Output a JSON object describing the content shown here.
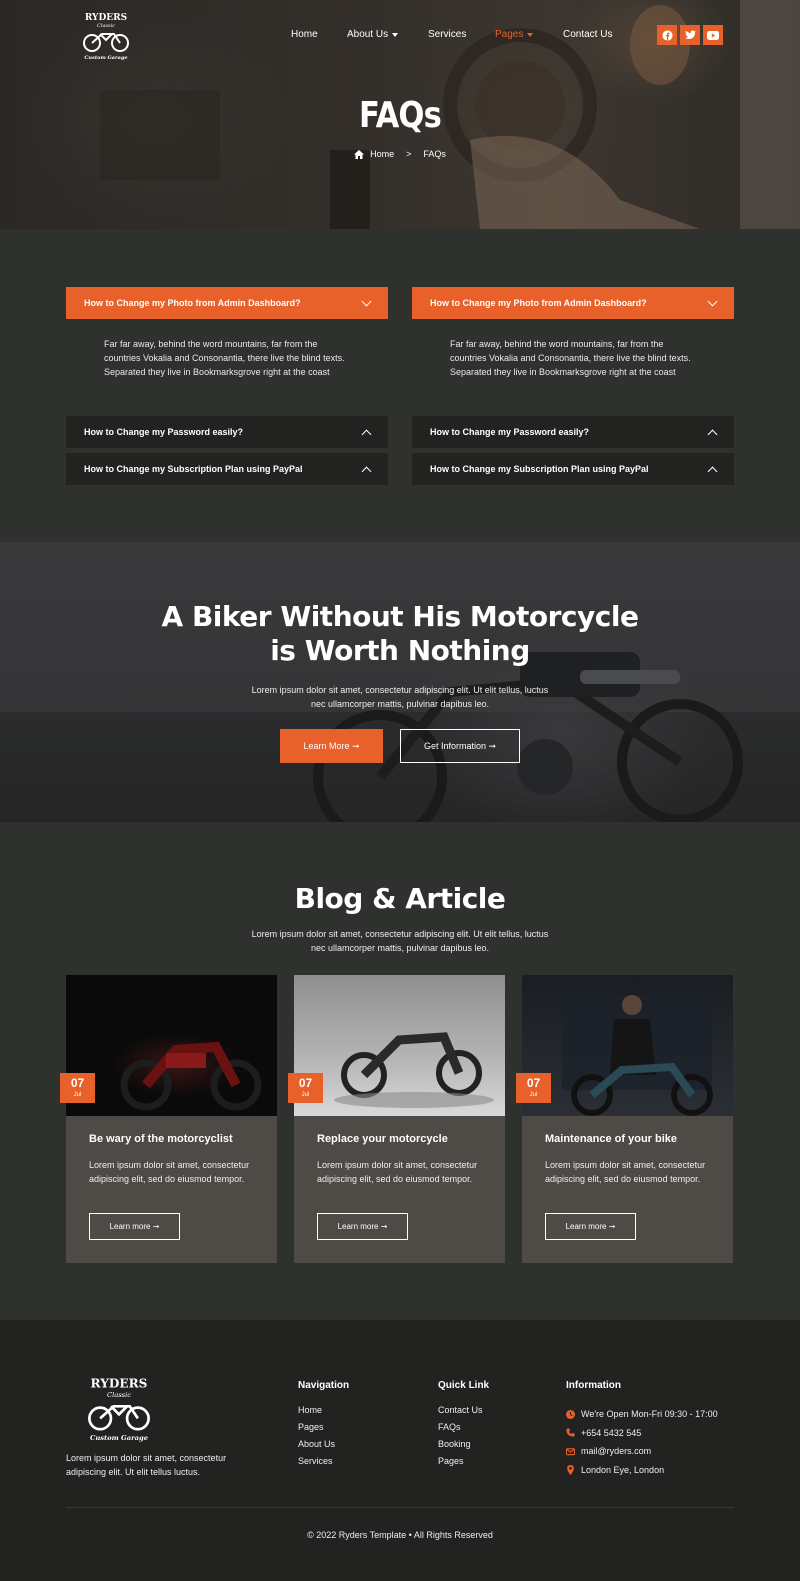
{
  "header": {
    "logo_top": "RYDERS",
    "logo_mid": "Classic",
    "logo_bottom": "Custom Garage",
    "nav": [
      {
        "label": "Home"
      },
      {
        "label": "About Us"
      },
      {
        "label": "Services"
      },
      {
        "label": "Pages"
      },
      {
        "label": "Contact Us"
      }
    ],
    "social": [
      "facebook-icon",
      "twitter-icon",
      "youtube-icon"
    ],
    "accent": "#e8602a"
  },
  "hero": {
    "title": "FAQs",
    "breadcrumb_home": "Home",
    "breadcrumb_sep": ">",
    "breadcrumb_current": "FAQs"
  },
  "faq": {
    "columns": [
      {
        "open_question": "How to Change my Photo from Admin Dashboard?",
        "open_answer": "Far far away, behind the word mountains, far from the countries Vokalia and Consonantia, there live the blind texts. Separated they live in Bookmarksgrove right at the coast",
        "q2": "How to Change my Password easily?",
        "q3": "How to Change my Subscription Plan using PayPal"
      },
      {
        "open_question": "How to Change my Photo from Admin Dashboard?",
        "open_answer": "Far far away, behind the word mountains, far from the countries Vokalia and Consonantia, there live the blind texts. Separated they live in Bookmarksgrove right at the coast",
        "q2": "How to Change my Password easily?",
        "q3": "How to Change my Subscription Plan using PayPal"
      }
    ]
  },
  "cta": {
    "title_line1": "A Biker Without His Motorcycle",
    "title_line2": "is Worth Nothing",
    "desc_line1": "Lorem ipsum dolor sit amet, consectetur adipiscing elit. Ut elit tellus, luctus",
    "desc_line2": "nec ullamcorper mattis, pulvinar dapibus leo.",
    "primary_button": "Learn More ➞",
    "secondary_button": "Get Information ➞"
  },
  "blog": {
    "title": "Blog & Article",
    "desc_line1": "Lorem ipsum dolor sit amet, consectetur adipiscing elit. Ut elit tellus, luctus",
    "desc_line2": "nec ullamcorper mattis, pulvinar dapibus leo.",
    "cards": [
      {
        "day": "07",
        "month": "Jul",
        "title": "Be wary of the motorcyclist",
        "text": "Lorem ipsum dolor sit amet, consectetur adipiscing elit, sed do eiusmod tempor.",
        "button": "Learn more ➞"
      },
      {
        "day": "07",
        "month": "Jul",
        "title": "Replace your motorcycle",
        "text": "Lorem ipsum dolor sit amet, consectetur adipiscing elit, sed do eiusmod tempor.",
        "button": "Learn more ➞"
      },
      {
        "day": "07",
        "month": "Jul",
        "title": "Maintenance of your bike",
        "text": "Lorem ipsum dolor sit amet, consectetur adipiscing elit, sed do eiusmod tempor.",
        "button": "Learn more ➞"
      }
    ]
  },
  "footer": {
    "about": "Lorem ipsum dolor sit amet, consectetur adipiscing elit. Ut elit tellus luctus.",
    "navigation": {
      "heading": "Navigation",
      "links": [
        "Home",
        "Pages",
        "About Us",
        "Services"
      ]
    },
    "quick_link": {
      "heading": "Quick Link",
      "links": [
        "Contact Us",
        "FAQs",
        "Booking",
        "Pages"
      ]
    },
    "information": {
      "heading": "Information",
      "items": [
        {
          "icon": "clock-icon",
          "text": "We're Open Mon-Fri 09:30 - 17:00"
        },
        {
          "icon": "phone-icon",
          "text": "+654 5432 545"
        },
        {
          "icon": "mail-icon",
          "text": "mail@ryders.com"
        },
        {
          "icon": "location-icon",
          "text": "London Eye, London"
        }
      ]
    },
    "copyright": "© 2022 Ryders Template • All Rights Reserved"
  }
}
